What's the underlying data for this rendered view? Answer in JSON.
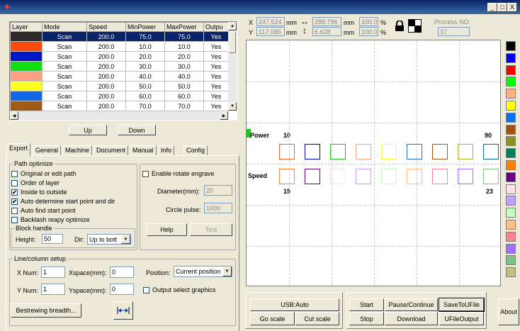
{
  "window": {
    "min_label": "_",
    "max_label": "□",
    "close_label": "X"
  },
  "table": {
    "headers": [
      "Layer",
      "Mode",
      "Speed",
      "MinPower",
      "MaxPower",
      "Outpu"
    ],
    "rows": [
      {
        "color": "#2a2a2a",
        "mode": "Scan",
        "speed": "200.0",
        "min": "75.0",
        "max": "75.0",
        "out": "Yes"
      },
      {
        "color": "#ff4a10",
        "mode": "Scan",
        "speed": "200.0",
        "min": "10.0",
        "max": "10.0",
        "out": "Yes"
      },
      {
        "color": "#0014c8",
        "mode": "Scan",
        "speed": "200.0",
        "min": "20.0",
        "max": "20.0",
        "out": "Yes"
      },
      {
        "color": "#10e010",
        "mode": "Scan",
        "speed": "200.0",
        "min": "30.0",
        "max": "30.0",
        "out": "Yes"
      },
      {
        "color": "#ffa080",
        "mode": "Scan",
        "speed": "200.0",
        "min": "40.0",
        "max": "40.0",
        "out": "Yes"
      },
      {
        "color": "#ffff20",
        "mode": "Scan",
        "speed": "200.0",
        "min": "50.0",
        "max": "50.0",
        "out": "Yes"
      },
      {
        "color": "#1068e8",
        "mode": "Scan",
        "speed": "200.0",
        "min": "60.0",
        "max": "60.0",
        "out": "Yes"
      },
      {
        "color": "#a05a18",
        "mode": "Scan",
        "speed": "200.0",
        "min": "70.0",
        "max": "70.0",
        "out": "Yes"
      }
    ]
  },
  "buttons": {
    "up": "Up",
    "down": "Down",
    "help": "Help",
    "test": "Test",
    "bestrewing": "Bestrewing breadth...",
    "usb": "USB:Auto",
    "goscale": "Go scale",
    "cutscale": "Cut scale",
    "start": "Start",
    "pause": "Pause/Continue",
    "save": "SaveToUFile",
    "stop": "Stop",
    "download": "Download",
    "ufileoutput": "UFileOutput",
    "about": "About"
  },
  "tabs": [
    "Export",
    "General",
    "Machine",
    "Document",
    "Manual",
    "Info",
    "Config"
  ],
  "path_optimize": {
    "title": "Path optimize",
    "items": [
      {
        "label": "Original or edit path",
        "checked": false
      },
      {
        "label": "Order of layer",
        "checked": false
      },
      {
        "label": "Inside to outside",
        "checked": true
      },
      {
        "label": "Auto determine start point and dir",
        "checked": true
      },
      {
        "label": "Auto find start point",
        "checked": false
      },
      {
        "label": "Backlash reapy optimize",
        "checked": false
      }
    ]
  },
  "block_handle": {
    "title": "Block handle",
    "height_label": "Height:",
    "height": "50",
    "dir_label": "Dir:",
    "dir": "Up to bott"
  },
  "rotate": {
    "label": "Enable rotate engrave",
    "diameter_label": "Diameter(mm):",
    "diameter": "20",
    "pulse_label": "Circle pulse:",
    "pulse": "1000"
  },
  "line_col": {
    "title": "Line/column setup",
    "xnum_label": "X Num:",
    "xnum": "1",
    "xspace_label": "Xspace(mm):",
    "xspace": "0",
    "ynum_label": "Y Num:",
    "ynum": "1",
    "yspace_label": "Yspace(mm):",
    "yspace": "0",
    "position_label": "Position:",
    "position": "Current position",
    "output_select": "Output select graphics"
  },
  "coords": {
    "x_label": "X",
    "x": "247.524",
    "y_label": "Y",
    "y": "117.085",
    "w": "288.786",
    "h": "6.628",
    "unit": "mm",
    "sx": "100.0",
    "sy": "100.0",
    "pct": "%",
    "process_label": "Process NO:",
    "process": "37"
  },
  "canvas": {
    "power_label": "Power",
    "speed_label": "Speed",
    "p_start": "10",
    "p_end": "90",
    "s_start": "15",
    "s_end": "23"
  },
  "palette": [
    "#000000",
    "#0000ff",
    "#ff0000",
    "#00ff00",
    "#ffb080",
    "#ffff00",
    "#0070ff",
    "#a05010",
    "#909020",
    "#008060",
    "#ff8000",
    "#6a0080",
    "#ffe0e8",
    "#c0a0ff",
    "#c0ffc0",
    "#ffc080",
    "#ff8090",
    "#a070ff",
    "#80c080",
    "#c0c080"
  ]
}
